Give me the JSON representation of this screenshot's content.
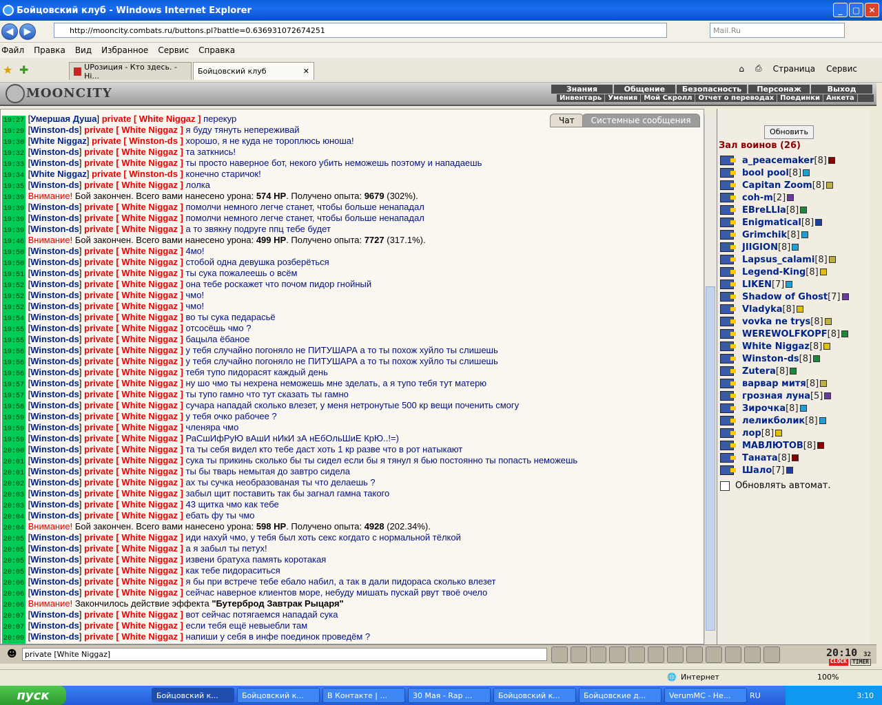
{
  "window": {
    "title": "Бойцовский клуб - Windows Internet Explorer"
  },
  "address": {
    "url": "http://mooncity.combats.ru/buttons.pl?battle=0.636931072674251",
    "search_placeholder": "Mail.Ru"
  },
  "menu": [
    "Файл",
    "Правка",
    "Вид",
    "Избранное",
    "Сервис",
    "Справка"
  ],
  "tabs": [
    {
      "label": "UPозиция - Кто здесь. - Hi...",
      "active": false
    },
    {
      "label": "Бойцовский клуб",
      "active": true
    }
  ],
  "ie_commands": {
    "page": "Страница",
    "service": "Сервис"
  },
  "site": {
    "logo": "MOONCITY",
    "nav": [
      "Знания",
      "Общение",
      "Безопасность",
      "Персонаж",
      "Выход"
    ],
    "subnav": [
      "Инвентарь",
      "Умения",
      "Мой Скролл",
      "Отчет о переводах",
      "Поединки",
      "Анкета"
    ]
  },
  "chat_tabs": [
    "Чат",
    "Системные сообщения"
  ],
  "chat": [
    {
      "t": "19:27",
      "kind": "msg",
      "from": "Умершая Душа",
      "to": "White Niggaz",
      "text": "перекур"
    },
    {
      "t": "19:29",
      "kind": "msg",
      "from": "Winston-ds",
      "to": "White Niggaz",
      "text": "я буду тянуть неперeживай"
    },
    {
      "t": "19:30",
      "kind": "msg",
      "from": "White Niggaz",
      "to": "Winston-ds",
      "text": "хорошо, я не куда не тороплюсь юноша!"
    },
    {
      "t": "19:32",
      "kind": "msg",
      "from": "Winston-ds",
      "to": "White Niggaz",
      "text": "та заткнись!"
    },
    {
      "t": "19:33",
      "kind": "msg",
      "from": "Winston-ds",
      "to": "White Niggaz",
      "text": "ты просто наверное бот, некого убить неможешь поэтому и нападаешь"
    },
    {
      "t": "19:34",
      "kind": "msg",
      "from": "White Niggaz",
      "to": "Winston-ds",
      "text": "конечно старичок!"
    },
    {
      "t": "19:35",
      "kind": "msg",
      "from": "Winston-ds",
      "to": "White Niggaz",
      "text": "лолка"
    },
    {
      "t": "19:39",
      "kind": "sys",
      "pre": "Бой закончен. Всего вами нанесено урона: ",
      "b1": "574 HP",
      "mid": ". Получено опыта: ",
      "b2": "9679",
      "post": " (302%)."
    },
    {
      "t": "19:39",
      "kind": "msg",
      "from": "Winston-ds",
      "to": "White Niggaz",
      "text": "помолчи немного легче станет, чтобы больше ненападал"
    },
    {
      "t": "19:39",
      "kind": "msg",
      "from": "Winston-ds",
      "to": "White Niggaz",
      "text": "помолчи немного легче станет, чтобы больше ненападал"
    },
    {
      "t": "19:39",
      "kind": "msg",
      "from": "Winston-ds",
      "to": "White Niggaz",
      "text": "а то звякну подруге ппц тебе будет"
    },
    {
      "t": "19:46",
      "kind": "sys",
      "pre": "Бой закончен. Всего вами нанесено урона: ",
      "b1": "499 HP",
      "mid": ". Получено опыта: ",
      "b2": "7727",
      "post": " (317.1%)."
    },
    {
      "t": "19:50",
      "kind": "msg",
      "from": "Winston-ds",
      "to": "White Niggaz",
      "text": "4мо!"
    },
    {
      "t": "19:50",
      "kind": "msg",
      "from": "Winston-ds",
      "to": "White Niggaz",
      "text": "стобой одна девушка розберёться"
    },
    {
      "t": "19:51",
      "kind": "msg",
      "from": "Winston-ds",
      "to": "White Niggaz",
      "text": "ты сука пожалеешь о всём"
    },
    {
      "t": "19:52",
      "kind": "msg",
      "from": "Winston-ds",
      "to": "White Niggaz",
      "text": "она тебе роскажет что почом пидор гнойный"
    },
    {
      "t": "19:52",
      "kind": "msg",
      "from": "Winston-ds",
      "to": "White Niggaz",
      "text": "чмо!"
    },
    {
      "t": "19:52",
      "kind": "msg",
      "from": "Winston-ds",
      "to": "White Niggaz",
      "text": "чмо!"
    },
    {
      "t": "19:54",
      "kind": "msg",
      "from": "Winston-ds",
      "to": "White Niggaz",
      "text": "во ты сука педарасьё"
    },
    {
      "t": "19:55",
      "kind": "msg",
      "from": "Winston-ds",
      "to": "White Niggaz",
      "text": "отсосёшь чмо ?"
    },
    {
      "t": "19:55",
      "kind": "msg",
      "from": "Winston-ds",
      "to": "White Niggaz",
      "text": "бацыла ёбаное"
    },
    {
      "t": "19:56",
      "kind": "msg",
      "from": "Winston-ds",
      "to": "White Niggaz",
      "text": "у тебя случайно погоняло не ПИТУШАРА а то ты похож хуйло ты слишешь"
    },
    {
      "t": "19:56",
      "kind": "msg",
      "from": "Winston-ds",
      "to": "White Niggaz",
      "text": "у тебя случайно погоняло не ПИТУШАРА а то ты похож хуйло ты слишешь"
    },
    {
      "t": "19:56",
      "kind": "msg",
      "from": "Winston-ds",
      "to": "White Niggaz",
      "text": "тебя тупо пидорасят каждый день"
    },
    {
      "t": "19:57",
      "kind": "msg",
      "from": "Winston-ds",
      "to": "White Niggaz",
      "text": "ну шо чмо ты нехрена неможешь мне зделать, а я тупо тебя тут матерю"
    },
    {
      "t": "19:57",
      "kind": "msg",
      "from": "Winston-ds",
      "to": "White Niggaz",
      "text": "ты тупо гамно что тут сказать ты гамно"
    },
    {
      "t": "19:58",
      "kind": "msg",
      "from": "Winston-ds",
      "to": "White Niggaz",
      "text": "сучара нападай сколько влезет, у меня нетронутые 500 кр вещи поченить смогу"
    },
    {
      "t": "19:59",
      "kind": "msg",
      "from": "Winston-ds",
      "to": "White Niggaz",
      "text": "у тебя очко рабочее ?"
    },
    {
      "t": "19:59",
      "kind": "msg",
      "from": "Winston-ds",
      "to": "White Niggaz",
      "text": "членяра чмо"
    },
    {
      "t": "19:59",
      "kind": "msg",
      "from": "Winston-ds",
      "to": "White Niggaz",
      "text": "РаСшИфРуЮ вАшИ нИкИ зА нЕбОльШиЕ КрЮ..!=)"
    },
    {
      "t": "20:00",
      "kind": "msg",
      "from": "Winston-ds",
      "to": "White Niggaz",
      "text": "та ты себя видел кто тебе даст хоть 1 кр разве что в рот натыкают"
    },
    {
      "t": "20:01",
      "kind": "msg",
      "from": "Winston-ds",
      "to": "White Niggaz",
      "text": "сука ты прикинь сколько бы ты сидел если бы я тянул я бью постоянно ты попасть неможешь"
    },
    {
      "t": "20:01",
      "kind": "msg",
      "from": "Winston-ds",
      "to": "White Niggaz",
      "text": "ты бы тварь немытая до завтро сидела"
    },
    {
      "t": "20:02",
      "kind": "msg",
      "from": "Winston-ds",
      "to": "White Niggaz",
      "text": "ах ты сучка необразованая ты что делаешь ?"
    },
    {
      "t": "20:03",
      "kind": "msg",
      "from": "Winston-ds",
      "to": "White Niggaz",
      "text": "забыл щит поставить так бы загнал гамна такого"
    },
    {
      "t": "20:03",
      "kind": "msg",
      "from": "Winston-ds",
      "to": "White Niggaz",
      "text": "43 щитка чмо как тебе"
    },
    {
      "t": "20:04",
      "kind": "msg",
      "from": "Winston-ds",
      "to": "White Niggaz",
      "text": "ебать фу ты чмо"
    },
    {
      "t": "20:04",
      "kind": "sys",
      "pre": "Бой закончен. Всего вами нанесено урона: ",
      "b1": "598 HP",
      "mid": ". Получено опыта: ",
      "b2": "4928",
      "post": " (202.34%)."
    },
    {
      "t": "20:05",
      "kind": "msg",
      "from": "Winston-ds",
      "to": "White Niggaz",
      "text": "иди нахуй чмо, у тебя был хоть секс когдато с нормальной тёлкой"
    },
    {
      "t": "20:05",
      "kind": "msg",
      "from": "Winston-ds",
      "to": "White Niggaz",
      "text": "а я забыл ты петух!"
    },
    {
      "t": "20:05",
      "kind": "msg",
      "from": "Winston-ds",
      "to": "White Niggaz",
      "text": "извени братуха память коротакая"
    },
    {
      "t": "20:05",
      "kind": "msg",
      "from": "Winston-ds",
      "to": "White Niggaz",
      "text": "как тебе пидораситься"
    },
    {
      "t": "20:06",
      "kind": "msg",
      "from": "Winston-ds",
      "to": "White Niggaz",
      "text": "я бы при встрече тебе ебало набил, а так в дали пидораса сколько влезет"
    },
    {
      "t": "20:06",
      "kind": "msg",
      "from": "Winston-ds",
      "to": "White Niggaz",
      "text": "сейчас наверное клиентов море, небуду мишать пускай рвут твоё очело"
    },
    {
      "t": "20:06",
      "kind": "sys",
      "pre": "Закончилось действие эффекта ",
      "b1": "\"Бутерброд Завтрак Рыцаря\"",
      "mid": "",
      "b2": "",
      "post": ""
    },
    {
      "t": "20:07",
      "kind": "msg",
      "from": "Winston-ds",
      "to": "White Niggaz",
      "text": "вот сейчас потягаемся нападай сука"
    },
    {
      "t": "20:07",
      "kind": "msg",
      "from": "Winston-ds",
      "to": "White Niggaz",
      "text": "если тебя ещё невыебли там"
    },
    {
      "t": "20:09",
      "kind": "msg",
      "from": "Winston-ds",
      "to": "White Niggaz",
      "text": "напиши у себя в инфе поединок проведём ?"
    }
  ],
  "labels": {
    "private": "private",
    "attention": "Внимание!"
  },
  "sidebar": {
    "refresh": "Обновить",
    "hall": "Зал воинов (26)",
    "auto": "Обновлять автомат.",
    "users": [
      {
        "name": "a_peacemaker",
        "lvl": "[8]",
        "color": "#8a0000"
      },
      {
        "name": "bool pool",
        "lvl": "[8]",
        "color": "#1ea0d8"
      },
      {
        "name": "Capitan Zoom",
        "lvl": "[8]",
        "color": "#c0b040"
      },
      {
        "name": "coh-m",
        "lvl": "[2]",
        "color": "#6a3aa0"
      },
      {
        "name": "EBreLLla",
        "lvl": "[8]",
        "color": "#1a8a3a"
      },
      {
        "name": "Enigmatical",
        "lvl": "[8]",
        "color": "#1e3ea0"
      },
      {
        "name": "Grimchik",
        "lvl": "[8]",
        "color": "#1ea0d8"
      },
      {
        "name": "JIIGION",
        "lvl": "[8]",
        "color": "#1ea0d8"
      },
      {
        "name": "Lapsus_calami",
        "lvl": "[8]",
        "color": "#c0b040"
      },
      {
        "name": "Legend-King",
        "lvl": "[8]",
        "color": "#e0c000"
      },
      {
        "name": "LIKEN",
        "lvl": "[7]",
        "color": "#1ea0d8"
      },
      {
        "name": "Shadow of Ghost",
        "lvl": "[7]",
        "color": "#6a3aa0"
      },
      {
        "name": "Vladyka",
        "lvl": "[8]",
        "color": "#e0c000"
      },
      {
        "name": "vovka ne trys",
        "lvl": "[8]",
        "color": "#c0b040"
      },
      {
        "name": "WEREWOLFKOPF",
        "lvl": "[8]",
        "color": "#1a8a3a"
      },
      {
        "name": "White Niggaz",
        "lvl": "[8]",
        "color": "#e0c000"
      },
      {
        "name": "Winston-ds",
        "lvl": "[8]",
        "color": "#1a8a3a"
      },
      {
        "name": "Zutera",
        "lvl": "[8]",
        "color": "#1a8a3a"
      },
      {
        "name": "варвар митя",
        "lvl": "[8]",
        "color": "#c0b040"
      },
      {
        "name": "грозная луна",
        "lvl": "[5]",
        "color": "#6a3aa0"
      },
      {
        "name": "Зирочка",
        "lvl": "[8]",
        "color": "#1ea0d8"
      },
      {
        "name": "леликболик",
        "lvl": "[8]",
        "color": "#1ea0d8"
      },
      {
        "name": "лор",
        "lvl": "[8]",
        "color": "#e0c000"
      },
      {
        "name": "МАВЛЮТОВ",
        "lvl": "[8]",
        "color": "#8a0000"
      },
      {
        "name": "Таната",
        "lvl": "[8]",
        "color": "#8a0000"
      },
      {
        "name": "Шало",
        "lvl": "[7]",
        "color": "#1e3ea0"
      }
    ]
  },
  "input": {
    "value": "private [White Niggaz]"
  },
  "clock": {
    "time": "20:10",
    "sec": "32",
    "l1": "CLOCK",
    "l2": "TIMER"
  },
  "status": {
    "zone": "Интернет",
    "zoom": "100%"
  },
  "taskbar": {
    "start": "пуск",
    "tasks": [
      "Бойцовский к...",
      "Бойцовский к...",
      "В Контакте | ...",
      "30 Мая - Rap ...",
      "Бойцовский к...",
      "Бойцовские д...",
      "VerumMC - Не..."
    ],
    "lang": "RU",
    "time": "3:10"
  }
}
